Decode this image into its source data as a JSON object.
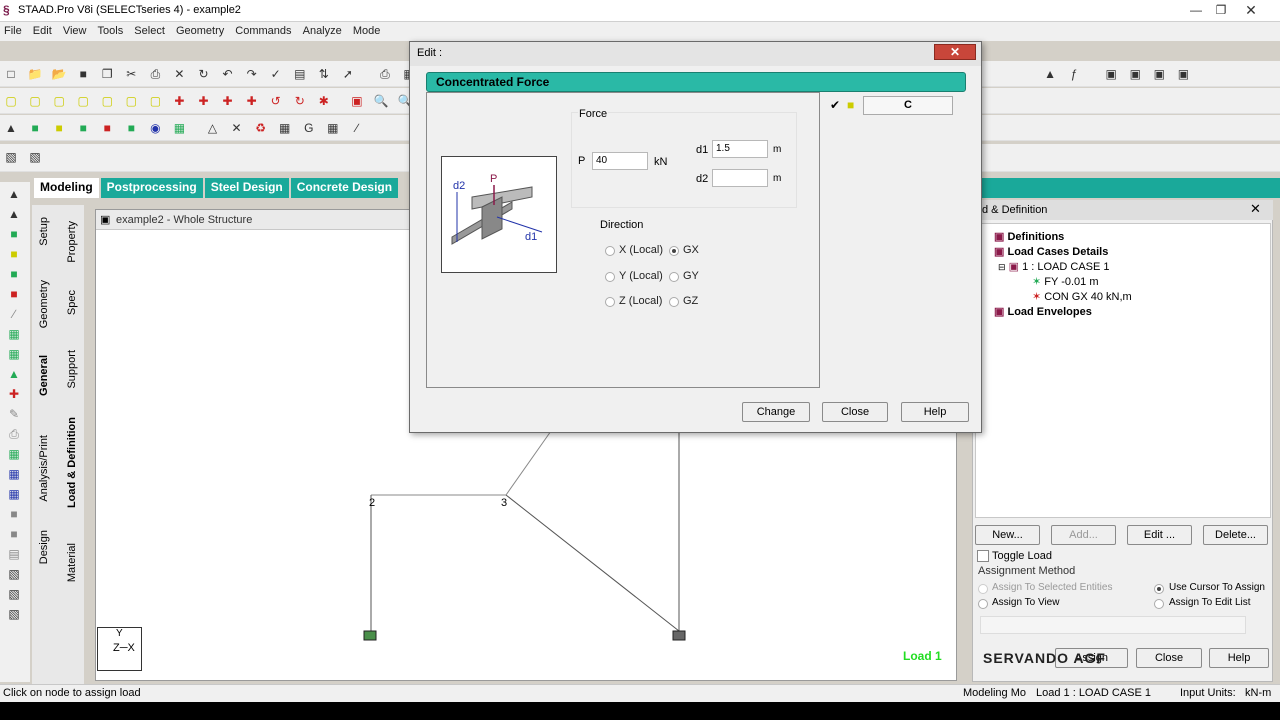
{
  "window": {
    "title": "STAAD.Pro V8i (SELECTseries 4) - example2",
    "min_icon": "minimize-icon",
    "max_icon": "maximize-icon",
    "close_icon": "close-icon"
  },
  "menu": [
    "File",
    "Edit",
    "View",
    "Tools",
    "Select",
    "Geometry",
    "Commands",
    "Analyze",
    "Mode"
  ],
  "tabs": [
    {
      "label": "Modeling",
      "active": true
    },
    {
      "label": "Postprocessing"
    },
    {
      "label": "Steel Design"
    },
    {
      "label": "Concrete Design"
    }
  ],
  "vertical_tabs": [
    "Setup",
    "Geometry",
    "General",
    "Analysis/Print",
    "Design",
    "Property",
    "Spec",
    "Support",
    "Load & Definition",
    "Material"
  ],
  "view": {
    "title": "example2 - Whole Structure",
    "nodes": [
      "2",
      "3"
    ],
    "axis_y": "Y",
    "axis_zx": "Z─X",
    "load_label": "Load 1"
  },
  "dialog": {
    "title": "Edit :",
    "banner": "Concentrated Force",
    "list_item": "C",
    "force": {
      "group_label": "Force",
      "p_label": "P",
      "p_value": "40",
      "p_unit": "kN",
      "d1_label": "d1",
      "d1_value": "1.5",
      "d1_unit": "m",
      "d2_label": "d2",
      "d2_value": "",
      "d2_unit": "m"
    },
    "figure": {
      "p": "P",
      "d1": "d1",
      "d2": "d2"
    },
    "direction": {
      "label": "Direction",
      "options": [
        "X (Local)",
        "GX",
        "Y (Local)",
        "GY",
        "Z (Local)",
        "GZ"
      ],
      "selected": "GX"
    },
    "buttons": {
      "change": "Change",
      "close": "Close",
      "help": "Help"
    }
  },
  "load_panel": {
    "title": "d & Definition",
    "tree": {
      "definitions": "Definitions",
      "load_cases": "Load Cases Details",
      "case1": "1 : LOAD CASE 1",
      "item1": "FY -0.01 m",
      "item2": "CON GX 40 kN,m",
      "envelopes": "Load Envelopes"
    },
    "buttons": {
      "new": "New...",
      "add": "Add...",
      "edit": "Edit ...",
      "delete": "Delete...",
      "assign": "Assign",
      "close": "Close",
      "help": "Help"
    },
    "toggle_load": "Toggle Load",
    "assignment_method": "Assignment Method",
    "assign_selected": "Assign To Selected Entities",
    "assign_view": "Assign To View",
    "use_cursor": "Use Cursor To Assign",
    "assign_edit_list": "Assign To Edit List",
    "watermark": "SERVANDO AGF"
  },
  "status": {
    "left": "Click on node to assign load",
    "mode": "Modeling Mo",
    "load": "Load 1 : LOAD CASE 1",
    "units_label": "Input Units:",
    "units": "kN-m"
  },
  "colors": {
    "teal": "#1aa99a",
    "banner": "#2ab9a6",
    "load_label": "#22dd22"
  }
}
